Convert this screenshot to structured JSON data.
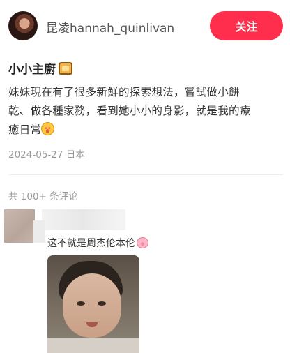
{
  "header": {
    "username": "昆凌hannah_quinlivan",
    "follow_label": "关注"
  },
  "post": {
    "title": "小小主廚",
    "title_icon": "bread-emoji-icon",
    "body_line_1": "妹妹現在有了很多新鮮的探索想法，嘗試做小餅",
    "body_line_2": "乾、做各種家務，看到她小小的身影，就是我的療",
    "body_line_3": "癒日常",
    "body_emoji": "smiling-hearts-emoji-icon",
    "date_location": "2024-05-27 日本"
  },
  "comments": {
    "count_label": "共 100+ 条评论",
    "items": [
      {
        "text": "这不就是周杰伦本伦",
        "emoji": "pig-face-emoji-icon"
      }
    ]
  },
  "colors": {
    "accent": "#ff2e4d",
    "meta_text": "#999999",
    "body_text": "#333333"
  }
}
